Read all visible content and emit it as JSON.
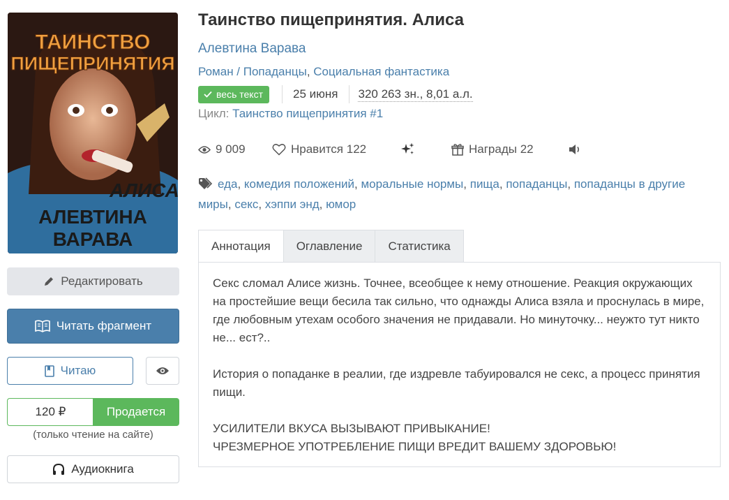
{
  "book": {
    "title": "Таинство пищепринятия. Алиса",
    "author": "Алевтина Варава",
    "genres": [
      "Роман",
      "Попаданцы",
      "Социальная фантастика"
    ],
    "badge": "весь текст",
    "date": "25 июня",
    "size": "320 263 зн., 8,01 а.л.",
    "cycle_label": "Цикл:",
    "cycle_name": "Таинство пищепринятия #1"
  },
  "cover": {
    "title_line1": "ТАИНСТВО",
    "title_line2": "ПИЩЕПРИНЯТИЯ",
    "subtitle": "АЛИСА",
    "author_line1": "АЛЕВТИНА",
    "author_line2": "ВАРАВА"
  },
  "stats": {
    "views": "9 009",
    "likes": "Нравится 122",
    "awards": "Награды 22"
  },
  "tags": [
    "еда",
    "комедия положений",
    "моральные нормы",
    "пища",
    "попаданцы",
    "попаданцы в другие миры",
    "секс",
    "хэппи энд",
    "юмор"
  ],
  "tabs": [
    "Аннотация",
    "Оглавление",
    "Статистика"
  ],
  "annotation": {
    "p1": "Секс сломал Алисе жизнь. Точнее, всеобщее к нему отношение. Реакция окружающих на простейшие вещи бесила так сильно, что однажды Алиса взяла и проснулась в мире, где любовным утехам особого значения не придавали. Но минуточку... неужто тут никто не... ест?..",
    "p2": "История о попаданке в реалии, где издревле табуировался не секс, а процесс принятия пищи.",
    "p3a": "УСИЛИТЕЛИ ВКУСА ВЫЗЫВАЮТ ПРИВЫКАНИЕ!",
    "p3b": "ЧРЕЗМЕРНОЕ УПОТРЕБЛЕНИЕ ПИЩИ ВРЕДИТ ВАШЕМУ ЗДОРОВЬЮ!"
  },
  "actions": {
    "edit": "Редактировать",
    "read_fragment": "Читать фрагмент",
    "reading": "Читаю",
    "price": "120 ₽",
    "sale": "Продается",
    "price_note": "(только чтение на сайте)",
    "audiobook": "Аудиокнига"
  },
  "colors": {
    "accent": "#4a7fab",
    "success": "#5cb85c"
  },
  "icons": [
    "pencil-icon",
    "book-open-icon",
    "bookmark-icon",
    "eye-icon",
    "headphones-icon",
    "check-icon",
    "heart-icon",
    "sparkles-icon",
    "gift-icon",
    "volume-icon",
    "tag-icon"
  ]
}
